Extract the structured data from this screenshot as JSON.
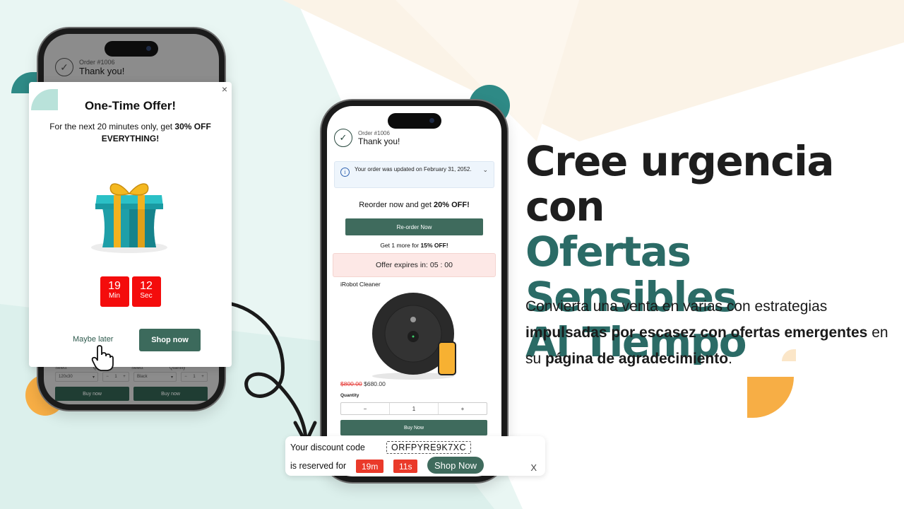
{
  "colors": {
    "brand_green": "#3f6b5d",
    "headline_teal": "#2b6b66",
    "timer_red": "#f40c0c",
    "chip_red": "#ea3a2a",
    "accent_orange": "#f7ae45",
    "accent_teal": "#2e8a86"
  },
  "left_phone": {
    "order_number": "Order #1006",
    "thank_you": "Thank you!",
    "select_label_1": "Select",
    "quantity_label_1": "Quantity",
    "select_label_2": "Select",
    "quantity_label_2": "Quantity",
    "select_value_1": "120x30",
    "select_value_2": "Black",
    "qty_value_1": "1",
    "qty_value_2": "1",
    "buy_now_1": "Buy now",
    "buy_now_2": "Buy now"
  },
  "popup": {
    "close_label": "×",
    "title": "One-Time Offer!",
    "desc_prefix": "For the next 20 minutes only, get ",
    "desc_bold": "30% OFF EVERYTHING",
    "desc_suffix": "!",
    "timer": [
      {
        "value": "19",
        "unit": "Min"
      },
      {
        "value": "12",
        "unit": "Sec"
      }
    ],
    "maybe_later": "Maybe later",
    "shop_now": "Shop now"
  },
  "middle_phone": {
    "order_number": "Order #1006",
    "thank_you": "Thank you!",
    "info_text": "Your order was updated on February 31, 2052.",
    "reorder_prefix": "Reorder now and get ",
    "reorder_bold": "20% OFF!",
    "reorder_button": "Re-order Now",
    "get_more_prefix": "Get 1 more for ",
    "get_more_bold": "15% OFF!",
    "offer_expires": "Offer expires in: 05 : 00",
    "product_name": "iRobot Cleaner",
    "old_price": "$800.00",
    "new_price": "$680.00",
    "quantity_label": "Quantity",
    "qty_minus": "−",
    "qty_value": "1",
    "qty_plus": "+",
    "buy_now": "Buy Now"
  },
  "discount_bar": {
    "line1": "Your discount code",
    "code": "ORFPYRE9K7XC",
    "line2": "is reserved for",
    "minutes": "19m",
    "seconds": "11s",
    "shop_now": "Shop Now",
    "close": "X"
  },
  "headline": {
    "line1": "Cree urgencia con",
    "line2": "Ofertas Sensibles",
    "line3": "Al Tiempo"
  },
  "subtext": {
    "part1": "Convierta una venta en varias con estrategias ",
    "bold1": "impulsadas por escasez con ofertas emergentes",
    "part2": " en su ",
    "bold2": "página de agradecimiento",
    "part3": "."
  }
}
